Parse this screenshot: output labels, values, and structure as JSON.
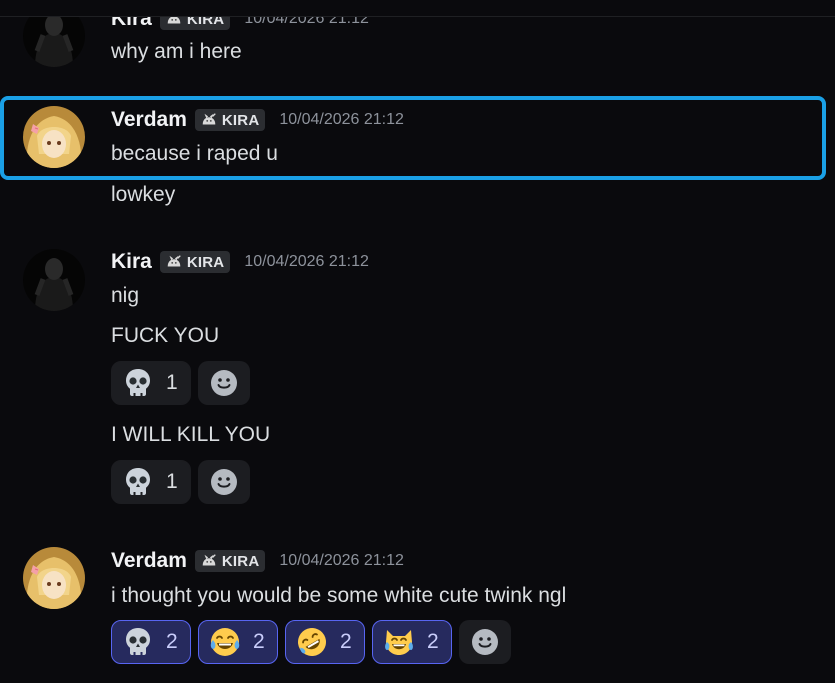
{
  "messages": [
    {
      "username": "Kira",
      "tag": "KIRA",
      "timestamp": "10/04/2026 21:12",
      "lines": [
        "why am i here"
      ]
    },
    {
      "username": "Verdam",
      "tag": "KIRA",
      "timestamp": "10/04/2026 21:12",
      "lines": [
        "because i raped u",
        "lowkey"
      ]
    },
    {
      "username": "Kira",
      "tag": "KIRA",
      "timestamp": "10/04/2026 21:12",
      "lines": [
        "nig",
        "FUCK YOU",
        "I WILL KILL YOU"
      ],
      "reactions_fuck_you": [
        {
          "icon": "skull-emoji",
          "count": "1"
        }
      ],
      "reactions_kill_you": [
        {
          "icon": "skull-emoji",
          "count": "1"
        }
      ]
    },
    {
      "username": "Verdam",
      "tag": "KIRA",
      "timestamp": "10/04/2026 21:12",
      "lines": [
        "i thought you would be some white cute twink ngl"
      ],
      "reactions": [
        {
          "icon": "skull-emoji",
          "count": "2"
        },
        {
          "icon": "joy-emoji",
          "count": "2"
        },
        {
          "icon": "rofl-emoji",
          "count": "2"
        },
        {
          "icon": "joy-cat-emoji",
          "count": "2"
        }
      ]
    }
  ],
  "colors": {
    "background": "#0a0a0d",
    "highlight_border": "#1aa0e6",
    "reaction_selected_bg": "#262a5e",
    "reaction_selected_border": "#5865f2"
  }
}
